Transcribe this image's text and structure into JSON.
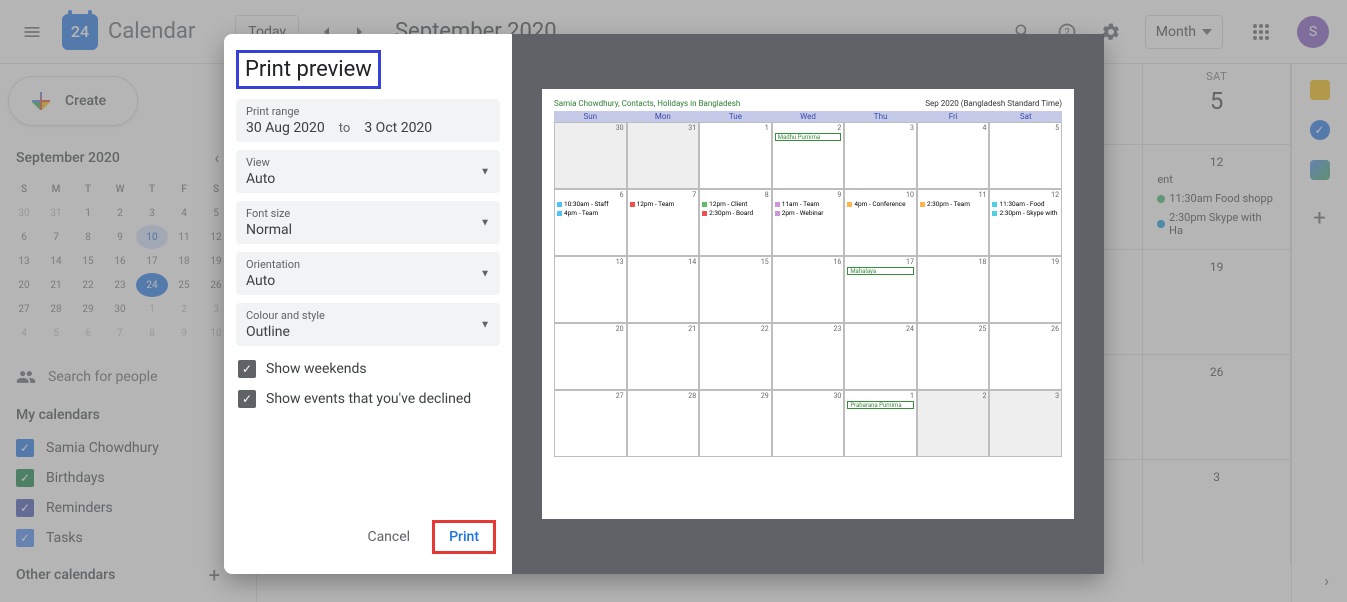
{
  "header": {
    "logo_day": "24",
    "app_title": "Calendar",
    "today_label": "Today",
    "month_title": "September 2020",
    "view_label": "Month",
    "avatar_letter": "S"
  },
  "sidebar": {
    "create_label": "Create",
    "mini_month": "September 2020",
    "dow": [
      "S",
      "M",
      "T",
      "W",
      "T",
      "F",
      "S"
    ],
    "weeks": [
      [
        {
          "d": "30",
          "dim": true
        },
        {
          "d": "31",
          "dim": true
        },
        {
          "d": "1"
        },
        {
          "d": "2"
        },
        {
          "d": "3"
        },
        {
          "d": "4"
        },
        {
          "d": "5"
        }
      ],
      [
        {
          "d": "6"
        },
        {
          "d": "7"
        },
        {
          "d": "8"
        },
        {
          "d": "9"
        },
        {
          "d": "10",
          "sel": true
        },
        {
          "d": "11"
        },
        {
          "d": "12"
        }
      ],
      [
        {
          "d": "13"
        },
        {
          "d": "14"
        },
        {
          "d": "15"
        },
        {
          "d": "16"
        },
        {
          "d": "17"
        },
        {
          "d": "18"
        },
        {
          "d": "19"
        }
      ],
      [
        {
          "d": "20"
        },
        {
          "d": "21"
        },
        {
          "d": "22"
        },
        {
          "d": "23"
        },
        {
          "d": "24",
          "today": true
        },
        {
          "d": "25"
        },
        {
          "d": "26"
        }
      ],
      [
        {
          "d": "27"
        },
        {
          "d": "28"
        },
        {
          "d": "29"
        },
        {
          "d": "30"
        },
        {
          "d": "1",
          "dim": true
        },
        {
          "d": "2",
          "dim": true
        },
        {
          "d": "3",
          "dim": true
        }
      ],
      [
        {
          "d": "4",
          "dim": true
        },
        {
          "d": "5",
          "dim": true
        },
        {
          "d": "6",
          "dim": true
        },
        {
          "d": "7",
          "dim": true
        },
        {
          "d": "8",
          "dim": true
        },
        {
          "d": "9",
          "dim": true
        },
        {
          "d": "10",
          "dim": true
        }
      ]
    ],
    "search_placeholder": "Search for people",
    "my_calendars_title": "My calendars",
    "calendars": [
      {
        "label": "Samia Chowdhury",
        "color": "#1a73e8"
      },
      {
        "label": "Birthdays",
        "color": "#0b8043"
      },
      {
        "label": "Reminders",
        "color": "#3f51b5"
      },
      {
        "label": "Tasks",
        "color": "#4285f4"
      }
    ],
    "other_calendars_title": "Other calendars"
  },
  "bg_grid": {
    "sat_label": "SAT",
    "days": [
      "5",
      "12",
      "19",
      "26",
      "3"
    ],
    "row2_fragments": [
      "ent",
      "11:30am Food shopp",
      "2:30pm Skype with Ha"
    ],
    "dot_colors": [
      "#33b679",
      "#039be5"
    ]
  },
  "dialog": {
    "title": "Print preview",
    "print_range_label": "Print range",
    "range_start": "30 Aug 2020",
    "range_to": "to",
    "range_end": "3 Oct 2020",
    "view_label": "View",
    "view_value": "Auto",
    "font_label": "Font size",
    "font_value": "Normal",
    "orientation_label": "Orientation",
    "orientation_value": "Auto",
    "colour_label": "Colour and style",
    "colour_value": "Outline",
    "chk_weekends": "Show weekends",
    "chk_declined": "Show events that you've declined",
    "cancel_label": "Cancel",
    "print_label": "Print"
  },
  "preview": {
    "meta_line": "Samia Chowdhury, Contacts, Holidays in Bangladesh",
    "month_right": "Sep 2020 (Bangladesh Standard Time)",
    "dow": [
      "Sun",
      "Mon",
      "Tue",
      "Wed",
      "Thu",
      "Fri",
      "Sat"
    ],
    "rows": [
      [
        {
          "n": "30",
          "gray": true
        },
        {
          "n": "31",
          "gray": true
        },
        {
          "n": "1"
        },
        {
          "n": "2",
          "bar": "Madhu Purnima"
        },
        {
          "n": "3"
        },
        {
          "n": "4"
        },
        {
          "n": "5"
        }
      ],
      [
        {
          "n": "6",
          "evs": [
            {
              "c": "#4fc3f7",
              "t": "10:30am - Staff"
            },
            {
              "c": "#4fc3f7",
              "t": "4pm - Team"
            }
          ]
        },
        {
          "n": "7",
          "evs": [
            {
              "c": "#ef5350",
              "t": "12pm - Team"
            }
          ]
        },
        {
          "n": "8",
          "evs": [
            {
              "c": "#66bb6a",
              "t": "12pm - Client"
            },
            {
              "c": "#ef5350",
              "t": "2:30pm - Board"
            }
          ]
        },
        {
          "n": "9",
          "evs": [
            {
              "c": "#ce93d8",
              "t": "11am - Team"
            },
            {
              "c": "#ce93d8",
              "t": "2pm - Webinar"
            }
          ]
        },
        {
          "n": "10",
          "evs": [
            {
              "c": "#ffb74d",
              "t": "4pm - Conference"
            }
          ]
        },
        {
          "n": "11",
          "evs": [
            {
              "c": "#ffb74d",
              "t": "2:30pm - Team"
            }
          ]
        },
        {
          "n": "12",
          "evs": [
            {
              "c": "#4dd0e1",
              "t": "11:30am - Food"
            },
            {
              "c": "#4dd0e1",
              "t": "2:30pm - Skype with"
            }
          ]
        }
      ],
      [
        {
          "n": "13"
        },
        {
          "n": "14"
        },
        {
          "n": "15"
        },
        {
          "n": "16"
        },
        {
          "n": "17",
          "bar": "Mahalaya"
        },
        {
          "n": "18"
        },
        {
          "n": "19"
        }
      ],
      [
        {
          "n": "20"
        },
        {
          "n": "21"
        },
        {
          "n": "22"
        },
        {
          "n": "23"
        },
        {
          "n": "24"
        },
        {
          "n": "25"
        },
        {
          "n": "26"
        }
      ],
      [
        {
          "n": "27"
        },
        {
          "n": "28"
        },
        {
          "n": "29"
        },
        {
          "n": "30"
        },
        {
          "n": "1",
          "bar": "Prabarana Purnima"
        },
        {
          "n": "2",
          "gray": true
        },
        {
          "n": "3",
          "gray": true
        }
      ]
    ]
  }
}
